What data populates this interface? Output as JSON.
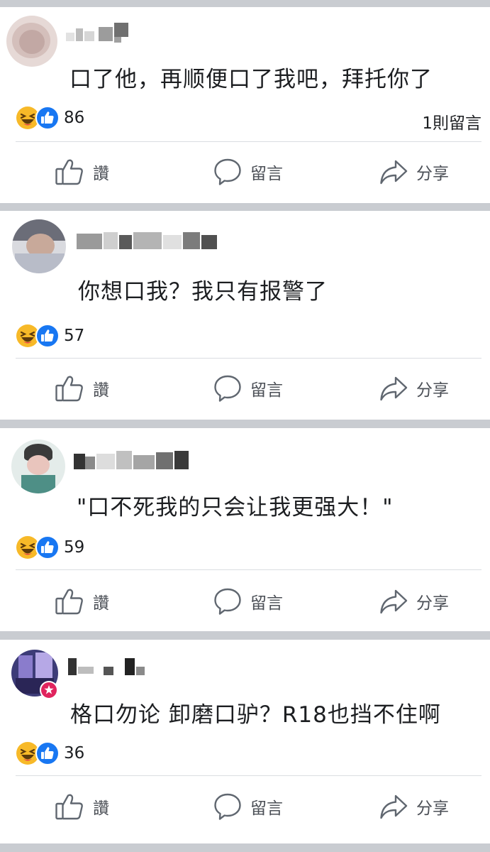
{
  "posts": [
    {
      "comment": "口了他，再顺便口了我吧，拜托你了",
      "reaction_count": "86",
      "comment_count": "1則留言"
    },
    {
      "comment": "你想口我？我只有报警了",
      "reaction_count": "57",
      "comment_count": ""
    },
    {
      "comment": "\"口不死我的只会让我更强大！\"",
      "reaction_count": "59",
      "comment_count": ""
    },
    {
      "comment": "格口勿论 卸磨口驴？R18也挡不住啊",
      "reaction_count": "36",
      "comment_count": ""
    }
  ],
  "actions": {
    "like_label": "讚",
    "comment_label": "留言",
    "share_label": "分享"
  },
  "colors": {
    "like_blue": "#1877f2",
    "haha_yellow": "#f7b928",
    "text": "#1c1e21",
    "action_gray": "#4b4f56",
    "separator": "#c9ccd1"
  },
  "icons": {
    "haha": "haha-emoji-icon",
    "like_reaction": "like-reaction-icon",
    "like": "thumbs-up-icon",
    "comment": "speech-bubble-icon",
    "share": "share-arrow-icon"
  }
}
